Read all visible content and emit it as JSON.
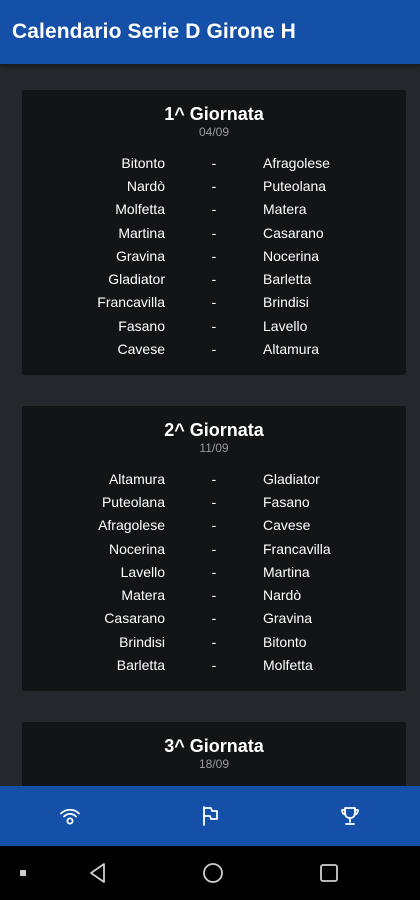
{
  "app_bar": {
    "title": "Calendario Serie D Girone H"
  },
  "rounds": [
    {
      "title": "1^ Giornata",
      "date": "04/09",
      "matches": [
        {
          "home": "Bitonto",
          "sep": "-",
          "away": "Afragolese"
        },
        {
          "home": "Nardò",
          "sep": "-",
          "away": "Puteolana"
        },
        {
          "home": "Molfetta",
          "sep": "-",
          "away": "Matera"
        },
        {
          "home": "Martina",
          "sep": "-",
          "away": "Casarano"
        },
        {
          "home": "Gravina",
          "sep": "-",
          "away": "Nocerina"
        },
        {
          "home": "Gladiator",
          "sep": "-",
          "away": "Barletta"
        },
        {
          "home": "Francavilla",
          "sep": "-",
          "away": "Brindisi"
        },
        {
          "home": "Fasano",
          "sep": "-",
          "away": "Lavello"
        },
        {
          "home": "Cavese",
          "sep": "-",
          "away": "Altamura"
        }
      ]
    },
    {
      "title": "2^ Giornata",
      "date": "11/09",
      "matches": [
        {
          "home": "Altamura",
          "sep": "-",
          "away": "Gladiator"
        },
        {
          "home": "Puteolana",
          "sep": "-",
          "away": "Fasano"
        },
        {
          "home": "Afragolese",
          "sep": "-",
          "away": "Cavese"
        },
        {
          "home": "Nocerina",
          "sep": "-",
          "away": "Francavilla"
        },
        {
          "home": "Lavello",
          "sep": "-",
          "away": "Martina"
        },
        {
          "home": "Matera",
          "sep": "-",
          "away": "Nardò"
        },
        {
          "home": "Casarano",
          "sep": "-",
          "away": "Gravina"
        },
        {
          "home": "Brindisi",
          "sep": "-",
          "away": "Bitonto"
        },
        {
          "home": "Barletta",
          "sep": "-",
          "away": "Molfetta"
        }
      ]
    },
    {
      "title": "3^ Giornata",
      "date": "18/09",
      "matches": []
    }
  ],
  "bottom_nav": {
    "items": [
      {
        "icon": "live-signal-icon"
      },
      {
        "icon": "flag-icon"
      },
      {
        "icon": "trophy-icon"
      }
    ]
  },
  "system_nav": {
    "items": [
      {
        "icon": "back-icon"
      },
      {
        "icon": "home-icon"
      },
      {
        "icon": "recents-icon"
      }
    ]
  },
  "colors": {
    "primary": "#1450a8",
    "background": "#24272b",
    "card": "#131416",
    "date_text": "#9a9a9a"
  }
}
